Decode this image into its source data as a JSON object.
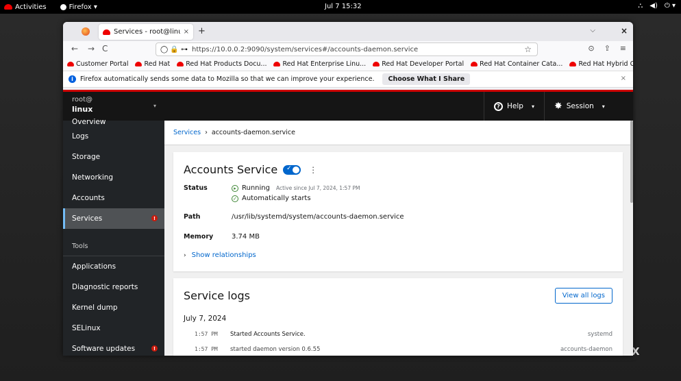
{
  "topbar": {
    "activities": "Activities",
    "app_menu": "Firefox ▾",
    "clock": "Jul 7  15:32",
    "tray": [
      "⛬",
      "◀)",
      "⏻ ▾"
    ]
  },
  "browser": {
    "tab_title": "Services - root@linux",
    "tab_close": "×",
    "new_tab": "+",
    "tabs_menu": "⌵",
    "window_close": "×",
    "back": "←",
    "forward": "→",
    "reload": "C",
    "url_icons": "◯ 🔒 ⊶",
    "url": "https://10.0.0.2:9090/system/services#/accounts-daemon.service",
    "star": "☆",
    "nav_right": [
      "⊙",
      "⇪",
      "≡"
    ],
    "bookmarks": [
      "Customer Portal",
      "Red Hat",
      "Red Hat Products Docu...",
      "Red Hat Enterprise Linu...",
      "Red Hat Developer Portal",
      "Red Hat Container Cata...",
      "Red Hat Hybrid Cloud ..."
    ],
    "notice": {
      "text": "Firefox automatically sends some data to Mozilla so that we can improve your experience.",
      "button": "Choose What I Share",
      "close": "×"
    }
  },
  "sidebar": {
    "user": "root@",
    "host": "linux",
    "caret": "▾",
    "items_top": [
      "Overview",
      "Logs",
      "Storage",
      "Networking",
      "Accounts",
      "Services"
    ],
    "section": "Tools",
    "items_tools": [
      "Applications",
      "Diagnostic reports",
      "Kernel dump",
      "SELinux",
      "Software updates"
    ]
  },
  "masthead": {
    "help": "Help",
    "session": "Session",
    "help_icon": "?",
    "caret": "▾"
  },
  "breadcrumb": {
    "parent": "Services",
    "sep": "›",
    "current": "accounts-daemon.service"
  },
  "service": {
    "title": "Accounts Service",
    "status_label": "Status",
    "status_running": "Running",
    "status_since": "Active since Jul 7, 2024, 1:57 PM",
    "status_auto": "Automatically starts",
    "path_label": "Path",
    "path": "/usr/lib/systemd/system/accounts-daemon.service",
    "memory_label": "Memory",
    "memory": "3.74 MB",
    "show_relationships": "Show relationships"
  },
  "logs": {
    "title": "Service logs",
    "view_all": "View all logs",
    "date": "July 7, 2024",
    "rows": [
      {
        "time": "1:57 PM",
        "message": "Started Accounts Service.",
        "source": "systemd"
      },
      {
        "time": "1:57 PM",
        "message": "started daemon version 0.6.55",
        "source": "accounts-daemon"
      }
    ]
  },
  "desktop": {
    "close": "X"
  },
  "colors": {
    "accent": "#0066cc",
    "redhat": "#ee0000",
    "success": "#3e8635",
    "danger": "#c9190b"
  }
}
